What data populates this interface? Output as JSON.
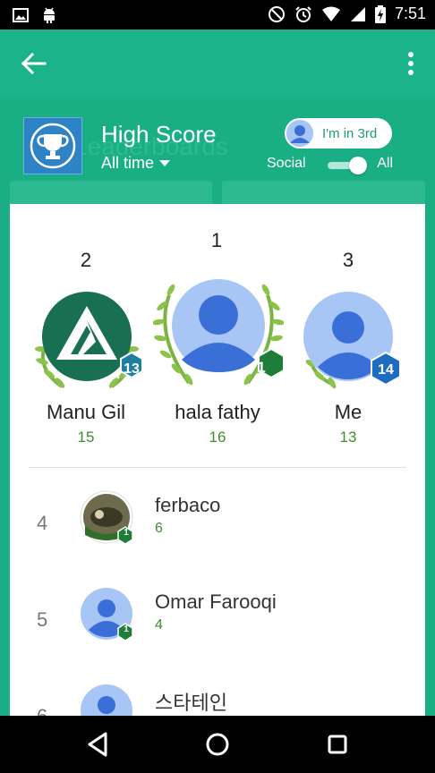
{
  "status_bar": {
    "time": "7:51",
    "icons": [
      "image-icon",
      "android-icon",
      "dnd-icon",
      "alarm-icon",
      "wifi-icon",
      "signal-icon",
      "battery-charging-icon"
    ]
  },
  "app_bar": {
    "back_icon": "arrow-back-icon",
    "menu_icon": "more-vert-icon",
    "background_title": "Leaderboards"
  },
  "header": {
    "title": "High Score",
    "time_filter": "All time",
    "rank_pill": "I'm in 3rd",
    "toggle_left": "Social",
    "toggle_right": "All",
    "toggle_state": "All"
  },
  "podium": [
    {
      "rank": "2",
      "name": "Manu Gil",
      "score": "15",
      "level": "13",
      "badge_color": "#1f7fa0"
    },
    {
      "rank": "1",
      "name": "hala fathy",
      "score": "16",
      "level": "1",
      "badge_color": "#1f7d3a"
    },
    {
      "rank": "3",
      "name": "Me",
      "score": "13",
      "level": "14",
      "badge_color": "#1e6cbf"
    }
  ],
  "list": [
    {
      "rank": "4",
      "name": "ferbaco",
      "score": "6",
      "level": "1"
    },
    {
      "rank": "5",
      "name": "Omar Farooqi",
      "score": "4",
      "level": "1"
    },
    {
      "rank": "6",
      "name": "스타테인",
      "score": "",
      "level": ""
    }
  ],
  "colors": {
    "accent_green": "#1bb38a",
    "score_green": "#3f8f2f",
    "trophy_blue": "#2e83c7"
  },
  "nav": {
    "back_icon": "nav-back-icon",
    "home_icon": "nav-home-icon",
    "recents_icon": "nav-recents-icon"
  }
}
